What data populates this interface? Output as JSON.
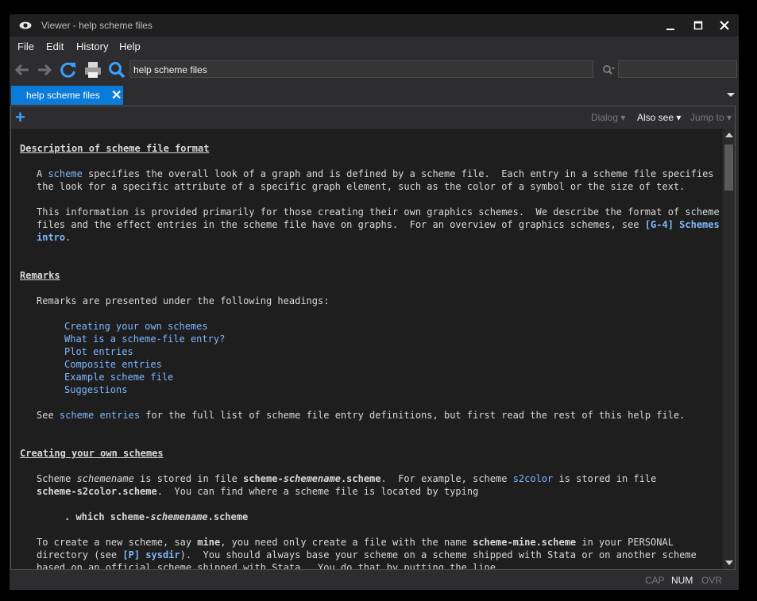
{
  "window": {
    "title": "Viewer - help scheme files"
  },
  "menu": [
    "File",
    "Edit",
    "History",
    "Help"
  ],
  "toolbar": {
    "url_value": "help scheme files",
    "find_value": ""
  },
  "tab": {
    "label": "help scheme files"
  },
  "subbar": {
    "dialog": "Dialog",
    "also_see": "Also see",
    "jump_to": "Jump to"
  },
  "doc": {
    "h_desc": "Description of scheme file format",
    "p1_a": "A ",
    "p1_link": "scheme",
    "p1_b": " specifies the overall look of a graph and is defined by a scheme file.  Each entry in a scheme file specifies",
    "p1_c": "the look for a specific attribute of a specific graph element, such as the color of a symbol or the size of text.",
    "p2_a": "This information is provided primarily for those creating their own graphics schemes.  We describe the format of scheme",
    "p2_b": "files and the effect entries in the scheme file have on graphs.  For an overview of graphics schemes, see ",
    "p2_link1": "[G-4] Schemes",
    "p2_link2": "intro",
    "p2_end": ".",
    "h_remarks": "Remarks",
    "remarks_intro": "Remarks are presented under the following headings:",
    "toc": [
      "Creating your own schemes",
      "What is a scheme-file entry?",
      "Plot entries",
      "Composite entries",
      "Example scheme file",
      "Suggestions"
    ],
    "see_a": "See ",
    "see_link": "scheme entries",
    "see_b": " for the full list of scheme file entry definitions, but first read the rest of this help file.",
    "h_create": "Creating your own schemes",
    "c1_a": "Scheme ",
    "c1_it": "schemename",
    "c1_b": " is stored in file ",
    "c1_f1": "scheme-",
    "c1_f2": "schemename",
    "c1_f3": ".scheme",
    "c1_c": ".  For example, scheme ",
    "c1_link": "s2color",
    "c1_d": " is stored in file",
    "c2_f": "scheme-s2color.scheme",
    "c2_b": ".  You can find where a scheme file is located by typing",
    "cmd_a": ". which scheme-",
    "cmd_it": "schemename",
    "cmd_b": ".scheme",
    "c3_a": "To create a new scheme, say ",
    "c3_b1": "mine",
    "c3_c": ", you need only create a file with the name ",
    "c3_b2": "scheme-mine.scheme",
    "c3_d": " in your PERSONAL",
    "c4_a": "directory (see ",
    "c4_link": "[P] sysdir",
    "c4_b": ").  You should always base your scheme on a scheme shipped with Stata or on another scheme",
    "c5": "based on an official scheme shipped with Stata.  You do that by putting the line"
  },
  "status": {
    "cap": "CAP",
    "num": "NUM",
    "ovr": "OVR"
  },
  "colors": {
    "accent": "#0a7bd8",
    "link": "#7fb7ff",
    "bg": "#1e1e1e"
  }
}
